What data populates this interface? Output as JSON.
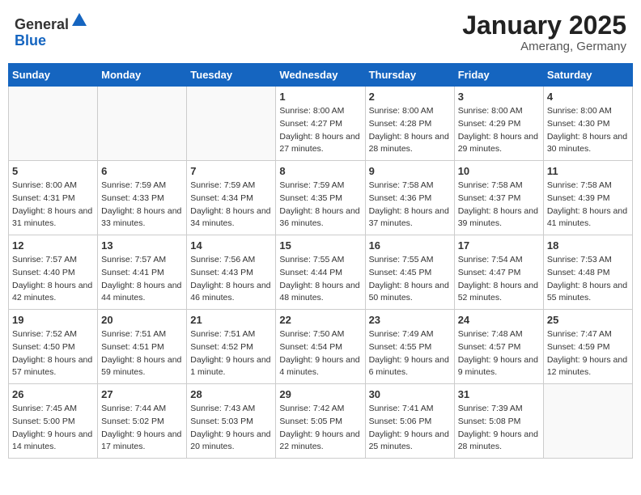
{
  "header": {
    "logo_general": "General",
    "logo_blue": "Blue",
    "month": "January 2025",
    "location": "Amerang, Germany"
  },
  "weekdays": [
    "Sunday",
    "Monday",
    "Tuesday",
    "Wednesday",
    "Thursday",
    "Friday",
    "Saturday"
  ],
  "weeks": [
    [
      {
        "day": "",
        "info": ""
      },
      {
        "day": "",
        "info": ""
      },
      {
        "day": "",
        "info": ""
      },
      {
        "day": "1",
        "info": "Sunrise: 8:00 AM\nSunset: 4:27 PM\nDaylight: 8 hours and 27 minutes."
      },
      {
        "day": "2",
        "info": "Sunrise: 8:00 AM\nSunset: 4:28 PM\nDaylight: 8 hours and 28 minutes."
      },
      {
        "day": "3",
        "info": "Sunrise: 8:00 AM\nSunset: 4:29 PM\nDaylight: 8 hours and 29 minutes."
      },
      {
        "day": "4",
        "info": "Sunrise: 8:00 AM\nSunset: 4:30 PM\nDaylight: 8 hours and 30 minutes."
      }
    ],
    [
      {
        "day": "5",
        "info": "Sunrise: 8:00 AM\nSunset: 4:31 PM\nDaylight: 8 hours and 31 minutes."
      },
      {
        "day": "6",
        "info": "Sunrise: 7:59 AM\nSunset: 4:33 PM\nDaylight: 8 hours and 33 minutes."
      },
      {
        "day": "7",
        "info": "Sunrise: 7:59 AM\nSunset: 4:34 PM\nDaylight: 8 hours and 34 minutes."
      },
      {
        "day": "8",
        "info": "Sunrise: 7:59 AM\nSunset: 4:35 PM\nDaylight: 8 hours and 36 minutes."
      },
      {
        "day": "9",
        "info": "Sunrise: 7:58 AM\nSunset: 4:36 PM\nDaylight: 8 hours and 37 minutes."
      },
      {
        "day": "10",
        "info": "Sunrise: 7:58 AM\nSunset: 4:37 PM\nDaylight: 8 hours and 39 minutes."
      },
      {
        "day": "11",
        "info": "Sunrise: 7:58 AM\nSunset: 4:39 PM\nDaylight: 8 hours and 41 minutes."
      }
    ],
    [
      {
        "day": "12",
        "info": "Sunrise: 7:57 AM\nSunset: 4:40 PM\nDaylight: 8 hours and 42 minutes."
      },
      {
        "day": "13",
        "info": "Sunrise: 7:57 AM\nSunset: 4:41 PM\nDaylight: 8 hours and 44 minutes."
      },
      {
        "day": "14",
        "info": "Sunrise: 7:56 AM\nSunset: 4:43 PM\nDaylight: 8 hours and 46 minutes."
      },
      {
        "day": "15",
        "info": "Sunrise: 7:55 AM\nSunset: 4:44 PM\nDaylight: 8 hours and 48 minutes."
      },
      {
        "day": "16",
        "info": "Sunrise: 7:55 AM\nSunset: 4:45 PM\nDaylight: 8 hours and 50 minutes."
      },
      {
        "day": "17",
        "info": "Sunrise: 7:54 AM\nSunset: 4:47 PM\nDaylight: 8 hours and 52 minutes."
      },
      {
        "day": "18",
        "info": "Sunrise: 7:53 AM\nSunset: 4:48 PM\nDaylight: 8 hours and 55 minutes."
      }
    ],
    [
      {
        "day": "19",
        "info": "Sunrise: 7:52 AM\nSunset: 4:50 PM\nDaylight: 8 hours and 57 minutes."
      },
      {
        "day": "20",
        "info": "Sunrise: 7:51 AM\nSunset: 4:51 PM\nDaylight: 8 hours and 59 minutes."
      },
      {
        "day": "21",
        "info": "Sunrise: 7:51 AM\nSunset: 4:52 PM\nDaylight: 9 hours and 1 minute."
      },
      {
        "day": "22",
        "info": "Sunrise: 7:50 AM\nSunset: 4:54 PM\nDaylight: 9 hours and 4 minutes."
      },
      {
        "day": "23",
        "info": "Sunrise: 7:49 AM\nSunset: 4:55 PM\nDaylight: 9 hours and 6 minutes."
      },
      {
        "day": "24",
        "info": "Sunrise: 7:48 AM\nSunset: 4:57 PM\nDaylight: 9 hours and 9 minutes."
      },
      {
        "day": "25",
        "info": "Sunrise: 7:47 AM\nSunset: 4:59 PM\nDaylight: 9 hours and 12 minutes."
      }
    ],
    [
      {
        "day": "26",
        "info": "Sunrise: 7:45 AM\nSunset: 5:00 PM\nDaylight: 9 hours and 14 minutes."
      },
      {
        "day": "27",
        "info": "Sunrise: 7:44 AM\nSunset: 5:02 PM\nDaylight: 9 hours and 17 minutes."
      },
      {
        "day": "28",
        "info": "Sunrise: 7:43 AM\nSunset: 5:03 PM\nDaylight: 9 hours and 20 minutes."
      },
      {
        "day": "29",
        "info": "Sunrise: 7:42 AM\nSunset: 5:05 PM\nDaylight: 9 hours and 22 minutes."
      },
      {
        "day": "30",
        "info": "Sunrise: 7:41 AM\nSunset: 5:06 PM\nDaylight: 9 hours and 25 minutes."
      },
      {
        "day": "31",
        "info": "Sunrise: 7:39 AM\nSunset: 5:08 PM\nDaylight: 9 hours and 28 minutes."
      },
      {
        "day": "",
        "info": ""
      }
    ]
  ]
}
